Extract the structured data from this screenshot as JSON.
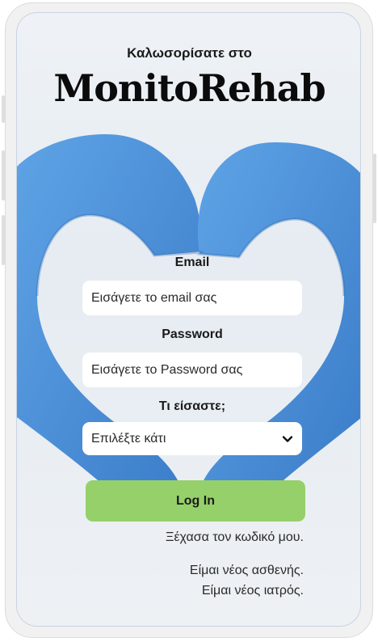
{
  "header": {
    "welcome": "Καλωσορίσατε στο",
    "brand": "MonitoRehab"
  },
  "form": {
    "email_label": "Email",
    "email_placeholder": "Εισάγετε το email σας",
    "password_label": "Password",
    "password_placeholder": "Εισάγετε το Password σας",
    "role_label": "Τι είσαστε;",
    "role_selected": "Επιλέξτε κάτι",
    "login_label": "Log In"
  },
  "links": {
    "forgot": "Ξέχασα τον κωδικό μου.",
    "new_patient": "Είμαι νέος ασθενής.",
    "new_doctor": "Είμαι νέος ιατρός."
  },
  "icons": {
    "select_chevron": "chevron-down-icon"
  },
  "colors": {
    "login_button": "#96d06a",
    "glove_blue": "#4a8fd6"
  }
}
